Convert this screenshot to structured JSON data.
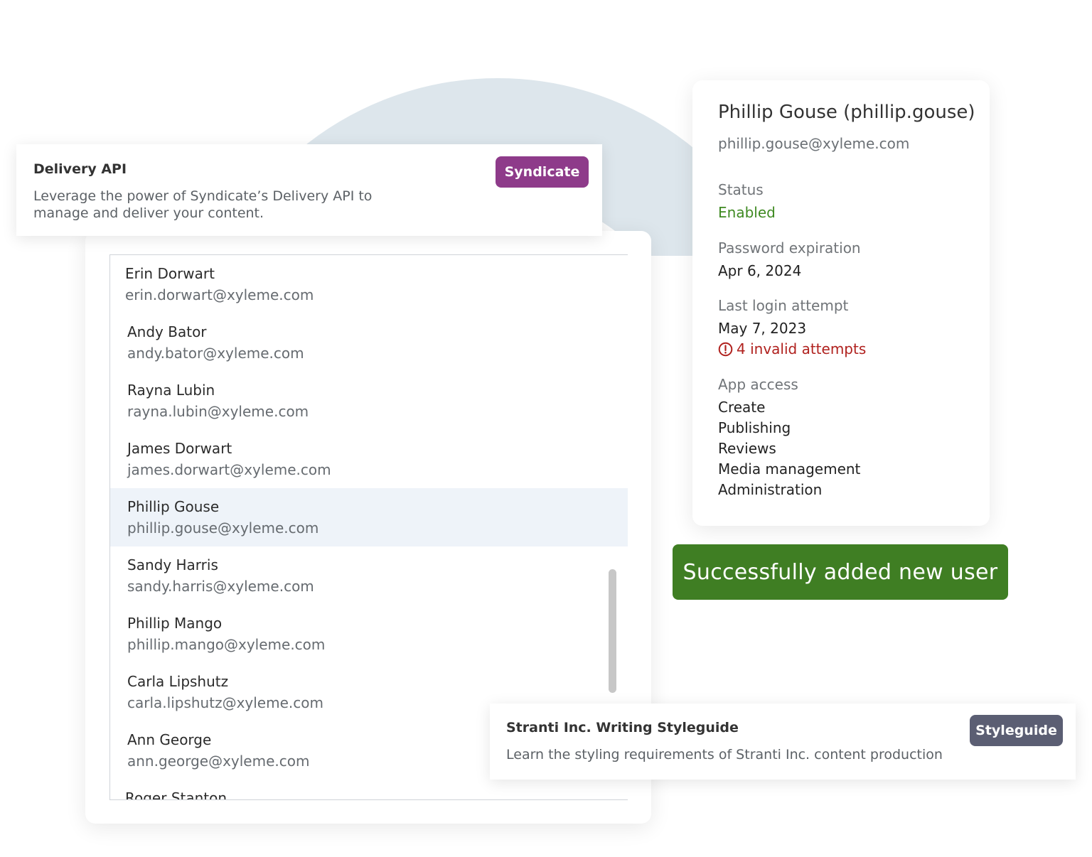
{
  "colors": {
    "syndicate_badge": "#8e3b8a",
    "styleguide_badge": "#5b5e73",
    "success_toast": "#3f7e23",
    "status_enabled": "#3f8a22",
    "warning": "#b0211e",
    "selected_row": "#eef3f9",
    "arc": "#dde6ec"
  },
  "api_card": {
    "title": "Delivery API",
    "description": "Leverage the power of Syndicate’s Delivery API to manage and deliver your content.",
    "badge": "Syndicate"
  },
  "users": [
    {
      "name": "Erin Dorwart",
      "email": "erin.dorwart@xyleme.com"
    },
    {
      "name": "Andy Bator",
      "email": "andy.bator@xyleme.com"
    },
    {
      "name": "Rayna Lubin",
      "email": "rayna.lubin@xyleme.com"
    },
    {
      "name": "James Dorwart",
      "email": "james.dorwart@xyleme.com"
    },
    {
      "name": "Phillip Gouse",
      "email": "phillip.gouse@xyleme.com"
    },
    {
      "name": "Sandy Harris",
      "email": "sandy.harris@xyleme.com"
    },
    {
      "name": "Phillip Mango",
      "email": "phillip.mango@xyleme.com"
    },
    {
      "name": "Carla Lipshutz",
      "email": "carla.lipshutz@xyleme.com"
    },
    {
      "name": "Ann George",
      "email": "ann.george@xyleme.com"
    },
    {
      "name": "Roger Stanton",
      "email": ""
    }
  ],
  "selected_user_index": 4,
  "detail": {
    "title": "Phillip Gouse (phillip.gouse)",
    "email": "phillip.gouse@xyleme.com",
    "status_label": "Status",
    "status_value": "Enabled",
    "password_label": "Password expiration",
    "password_value": "Apr 6, 2024",
    "login_label": "Last login attempt",
    "login_value": "May 7, 2023",
    "invalid_attempts": "4 invalid attempts",
    "warning_icon": "alert-circle-icon",
    "app_access_label": "App access",
    "app_access": [
      "Create",
      "Publishing",
      "Reviews",
      "Media management",
      "Administration"
    ]
  },
  "toast": {
    "message": "Successfully added new user"
  },
  "styleguide_card": {
    "title": "Stranti Inc. Writing Styleguide",
    "description": "Learn the styling requirements of Stranti Inc. content production",
    "badge": "Styleguide"
  }
}
